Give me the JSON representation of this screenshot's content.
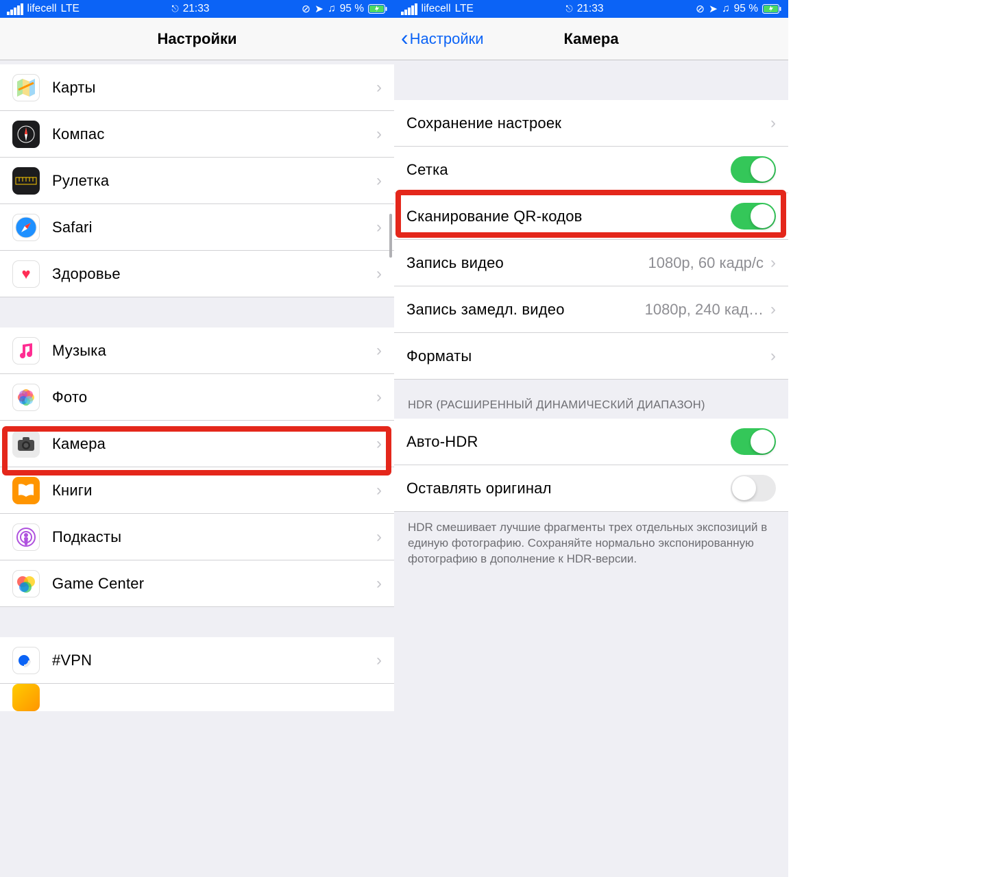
{
  "status_bar": {
    "carrier": "lifecell",
    "network": "LTE",
    "time": "21:33",
    "battery_percent": "95 %"
  },
  "left": {
    "title": "Настройки",
    "group1": [
      {
        "key": "maps",
        "label": "Карты"
      },
      {
        "key": "compass",
        "label": "Компас"
      },
      {
        "key": "ruler",
        "label": "Рулетка"
      },
      {
        "key": "safari",
        "label": "Safari"
      },
      {
        "key": "health",
        "label": "Здоровье"
      }
    ],
    "group2": [
      {
        "key": "music",
        "label": "Музыка"
      },
      {
        "key": "photo",
        "label": "Фото"
      },
      {
        "key": "camera",
        "label": "Камера",
        "highlighted": true
      },
      {
        "key": "books",
        "label": "Книги"
      },
      {
        "key": "podcasts",
        "label": "Подкасты"
      },
      {
        "key": "gc",
        "label": "Game Center"
      }
    ],
    "group3": [
      {
        "key": "vpn",
        "label": "#VPN"
      }
    ]
  },
  "right": {
    "back_label": "Настройки",
    "title": "Камера",
    "rows": {
      "preserve": {
        "label": "Сохранение настроек"
      },
      "grid": {
        "label": "Сетка",
        "toggle": true
      },
      "qr": {
        "label": "Сканирование QR-кодов",
        "toggle": true,
        "highlighted": true
      },
      "video": {
        "label": "Запись видео",
        "detail": "1080p, 60 кадр/с"
      },
      "slomo": {
        "label": "Запись замедл. видео",
        "detail": "1080p, 240 кад…"
      },
      "formats": {
        "label": "Форматы"
      },
      "auto_hdr": {
        "label": "Авто-HDR",
        "toggle": true
      },
      "keep_orig": {
        "label": "Оставлять оригинал",
        "toggle": false
      }
    },
    "hdr_header": "HDR (РАСШИРЕННЫЙ ДИНАМИЧЕСКИЙ ДИАПАЗОН)",
    "hdr_footer": "HDR смешивает лучшие фрагменты трех отдельных экспозиций в единую фотографию. Сохраняйте нормально экспонированную фотографию в дополнение к HDR-версии."
  }
}
